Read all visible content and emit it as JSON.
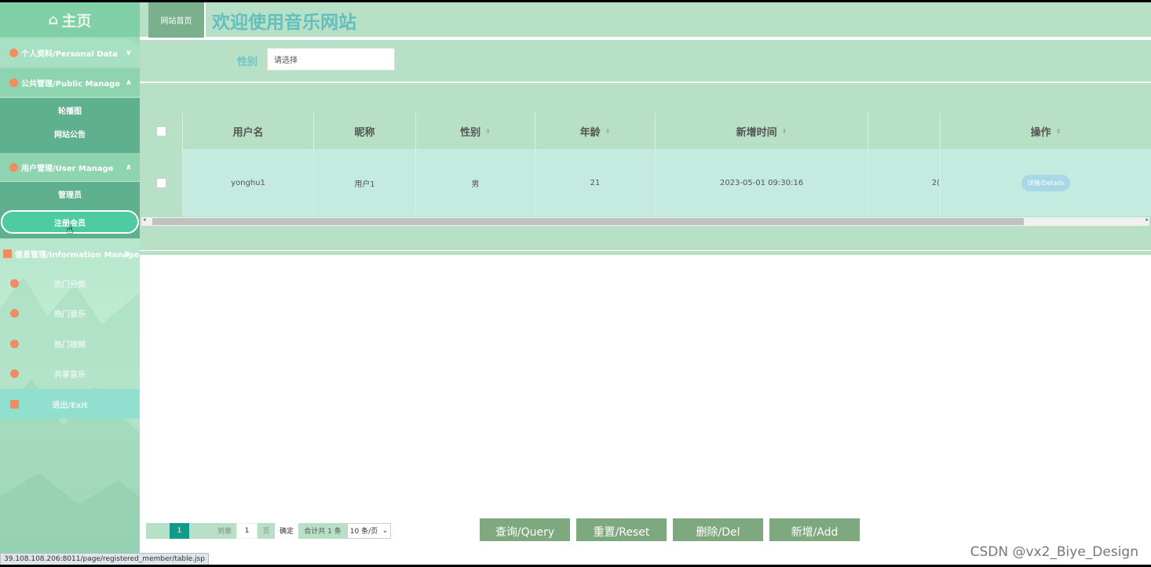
{
  "sidebar": {
    "home_label": "主页",
    "groups": [
      {
        "label": "个人资料/Personal Data",
        "chevron": "∨"
      },
      {
        "label": "公共管理/Public Manage",
        "chevron": "∧"
      },
      {
        "label": "用户管理/User Manage",
        "chevron": "∧"
      },
      {
        "label": "信息管理/Information Manage",
        "chevron": "∨"
      }
    ],
    "public_items": [
      "轮播图",
      "网站公告"
    ],
    "user_items": [
      "管理员",
      "注册会员"
    ],
    "info_items": [
      "热门分类",
      "热门音乐",
      "热门视频",
      "共享音乐"
    ],
    "exit_label": "退出/Exit"
  },
  "header": {
    "home_tab": "网站首页",
    "title": "欢迎使用音乐网站"
  },
  "search": {
    "gender_label": "性别",
    "gender_placeholder": "请选择"
  },
  "table": {
    "columns": [
      "用户名",
      "昵称",
      "性别",
      "年龄",
      "新增时间",
      "操作"
    ],
    "rows": [
      {
        "username": "yonghu1",
        "nickname": "用户1",
        "gender": "男",
        "age": "21",
        "created": "2023-05-01 09:30:16",
        "cut_text": "2(",
        "action": "详情/Details"
      }
    ]
  },
  "pager": {
    "current": "1",
    "goto": "到第",
    "page_input": "1",
    "page_unit": "页",
    "ok": "确定",
    "total": "合计共 1 条",
    "page_size": "10 条/页"
  },
  "actions": {
    "query": "查询/Query",
    "reset": "重置/Reset",
    "delete": "删除/Del",
    "add": "新增/Add"
  },
  "status_url": "39.108.108.206:8011/page/registered_member/table.jsp",
  "watermark": "CSDN @vx2_Biye_Design",
  "colors": {
    "accent": "#119a8c",
    "panel": "#b8e0c6",
    "sidebar_sub": "#5fb08f",
    "button": "#7ea87e"
  }
}
